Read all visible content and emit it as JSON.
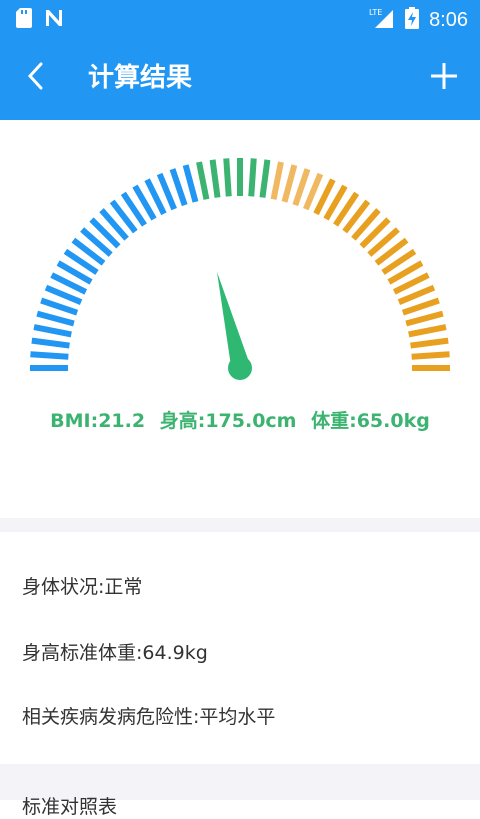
{
  "status_bar": {
    "time": "8:06",
    "network": "LTE",
    "icons": [
      "sd-card-icon",
      "n-notification-icon",
      "lte-signal-icon",
      "battery-charging-icon"
    ]
  },
  "app_bar": {
    "title": "计算结果",
    "back_icon": "chevron-left-icon",
    "add_icon": "plus-icon",
    "background": "#2196F3"
  },
  "gauge": {
    "needle_color": "#2EB872",
    "colors": {
      "blue": "#2196F3",
      "green": "#3CB371",
      "light_orange": "#F0B860",
      "orange": "#E8A020"
    }
  },
  "result": {
    "bmi_text": "BMI:21.2",
    "height_text": "身高:175.0cm",
    "weight_text": "体重:65.0kg"
  },
  "info": {
    "status": "身体状况:正常",
    "standard_weight": "身高标准体重:64.9kg",
    "risk": "相关疾病发病危险性:平均水平"
  },
  "section": {
    "title": "标准对照表"
  }
}
